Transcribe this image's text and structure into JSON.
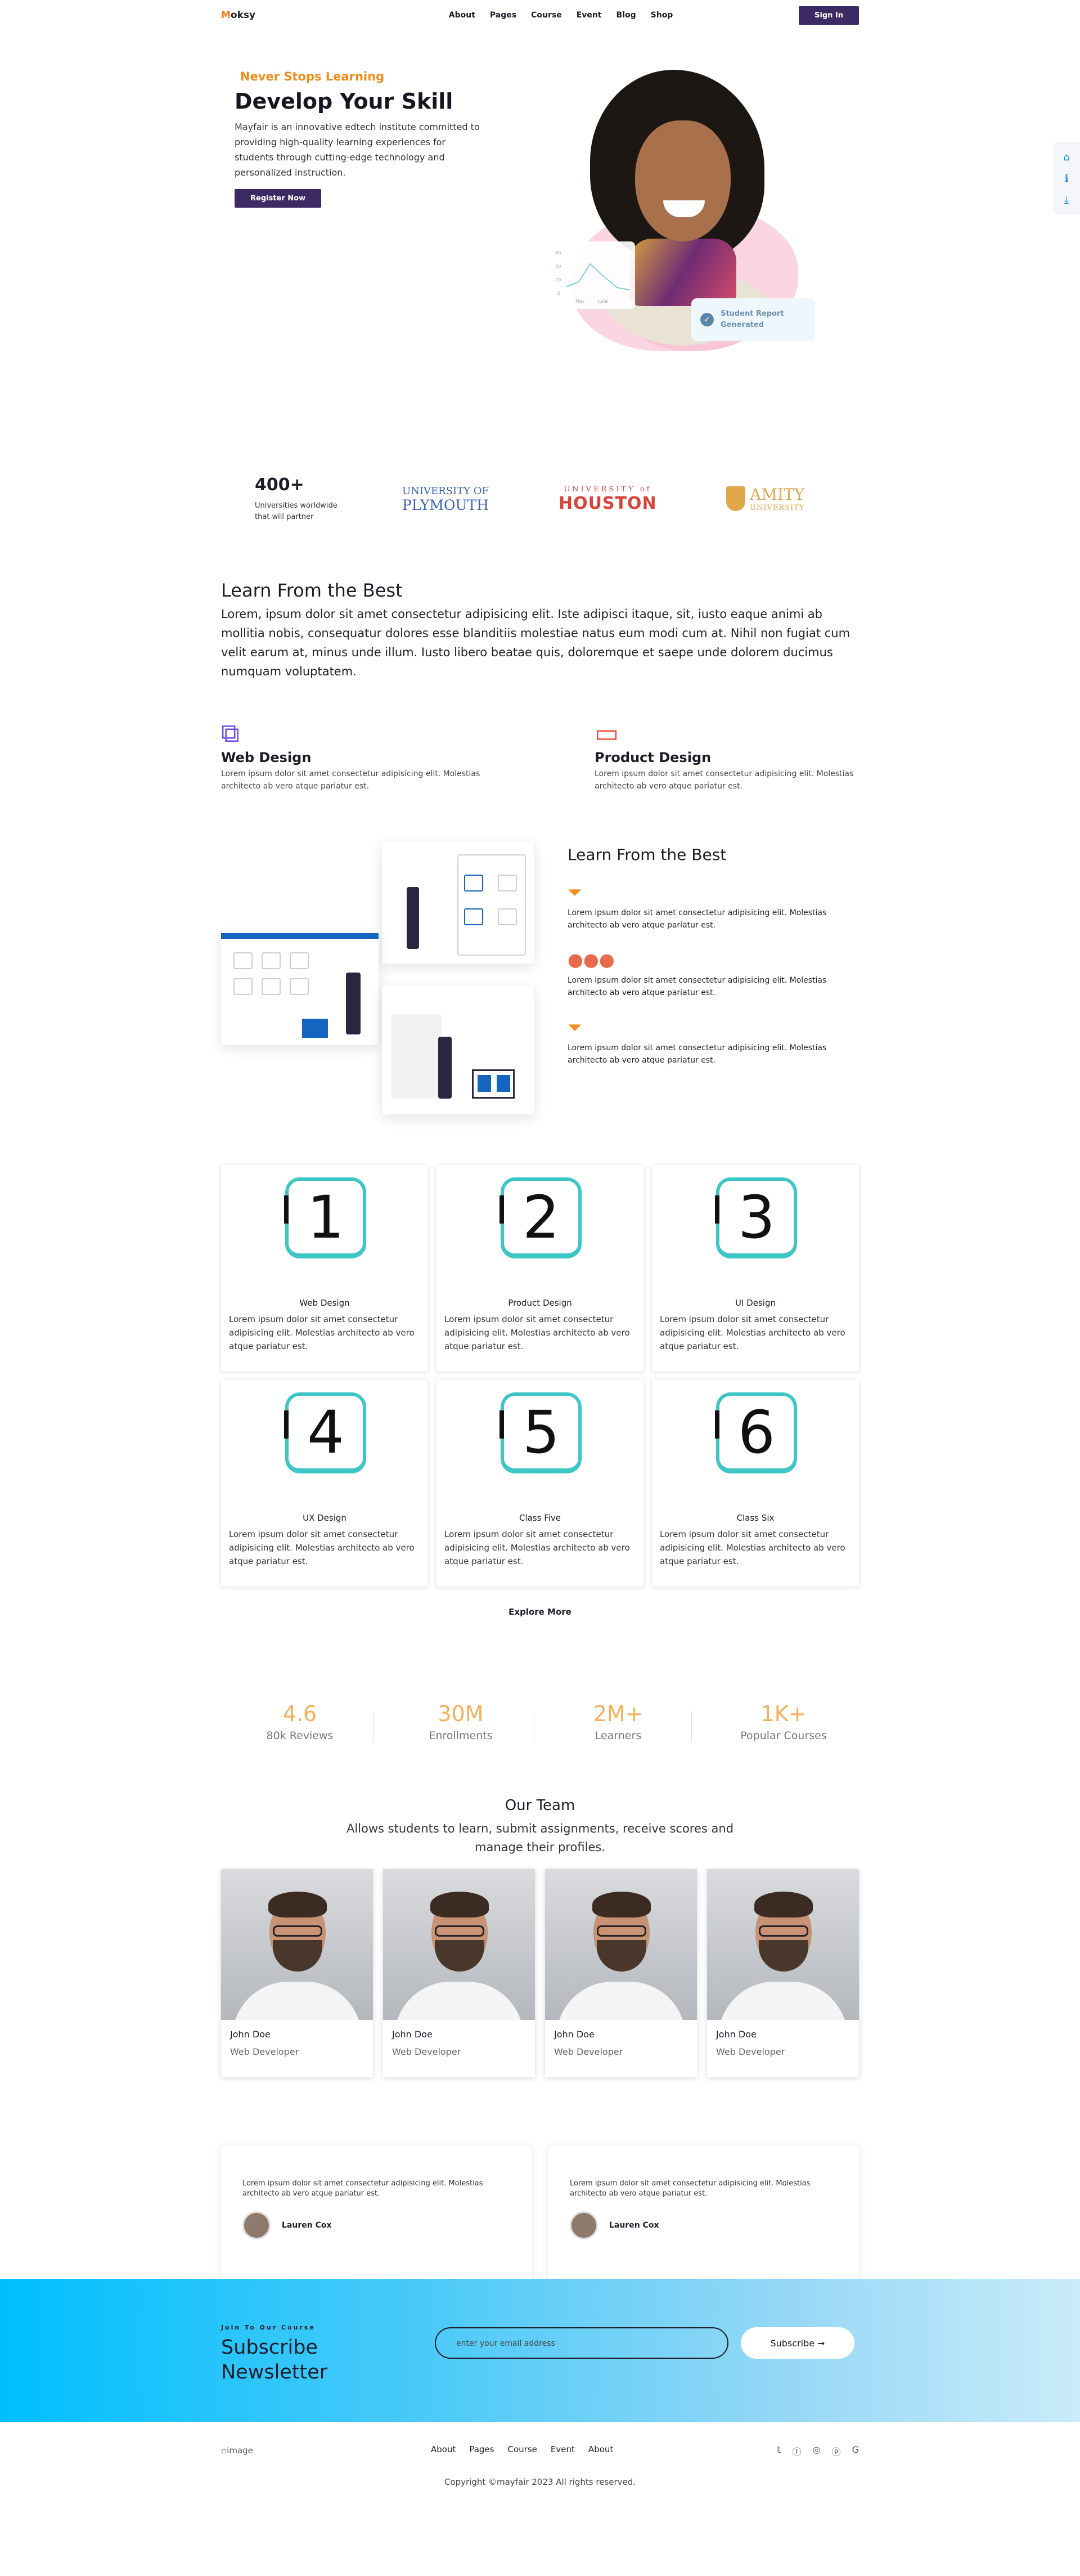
{
  "nav": {
    "logo_initial": "M",
    "logo_rest": "oksy",
    "links": [
      "About",
      "Pages",
      "Course",
      "Event",
      "Blog",
      "Shop"
    ],
    "signin_label": "Sign In"
  },
  "side_tools": [
    "home-icon",
    "info-icon",
    "download-icon"
  ],
  "hero": {
    "kicker": "Never Stops Learning",
    "title": "Develop Your Skill",
    "text": "Mayfair is an innovative edtech institute committed to providing high-quality learning experiences for students through cutting-edge technology and personalized instruction.",
    "button_label": "Register Now",
    "chart_ticks": [
      "60",
      "40",
      "20",
      "0"
    ],
    "chart_months": [
      "May",
      "June"
    ],
    "report_line1": "Student Report",
    "report_line2": "Generated"
  },
  "partners": {
    "count": "400+",
    "count_text": "Universities worldwide that will partner",
    "plymouth_a": "UNIVERSITY OF",
    "plymouth_b": "PLYMOUTH",
    "houston_a": "UNIVERSITY of",
    "houston_b": "HOUSTON",
    "amity_b": "AMITY",
    "amity_a": "UNIVERSITY"
  },
  "learn": {
    "title": "Learn From the Best",
    "text": "Lorem, ipsum dolor sit amet consectetur adipisicing elit. Iste adipisci itaque, sit, iusto eaque animi ab mollitia nobis, consequatur dolores esse blanditiis molestiae natus eum modi cum at. Nihil non fugiat cum velit earum at, minus unde illum. Iusto libero beatae quis, doloremque et saepe unde dolorem ducimus numquam voluptatem."
  },
  "features": [
    {
      "title": "Web Design",
      "text": "Lorem ipsum dolor sit amet consectetur adipisicing elit. Molestias architecto ab vero atque pariatur est.",
      "color": "#6c4ee0"
    },
    {
      "title": "Product Design",
      "text": "Lorem ipsum dolor sit amet consectetur adipisicing elit. Molestias architecto ab vero atque pariatur est.",
      "color": "#e94e3c"
    }
  ],
  "learn_list": {
    "title": "Learn From the Best",
    "items": [
      "Lorem ipsum dolor sit amet consectetur adipisicing elit. Molestias architecto ab vero atque pariatur est.",
      "Lorem ipsum dolor sit amet consectetur adipisicing elit. Molestias architecto ab vero atque pariatur est.",
      "Lorem ipsum dolor sit amet consectetur adipisicing elit. Molestias architecto ab vero atque pariatur est."
    ]
  },
  "courses": [
    {
      "num": "1",
      "title": "Web Design",
      "text": "Lorem ipsum dolor sit amet consectetur adipisicing elit. Molestias architecto ab vero atque pariatur est."
    },
    {
      "num": "2",
      "title": "Product Design",
      "text": "Lorem ipsum dolor sit amet consectetur adipisicing elit. Molestias architecto ab vero atque pariatur est."
    },
    {
      "num": "3",
      "title": "UI Design",
      "text": "Lorem ipsum dolor sit amet consectetur adipisicing elit. Molestias architecto ab vero atque pariatur est."
    },
    {
      "num": "4",
      "title": "UX Design",
      "text": "Lorem ipsum dolor sit amet consectetur adipisicing elit. Molestias architecto ab vero atque pariatur est."
    },
    {
      "num": "5",
      "title": "Class Five",
      "text": "Lorem ipsum dolor sit amet consectetur adipisicing elit. Molestias architecto ab vero atque pariatur est."
    },
    {
      "num": "6",
      "title": "Class Six",
      "text": "Lorem ipsum dolor sit amet consectetur adipisicing elit. Molestias architecto ab vero atque pariatur est."
    }
  ],
  "explore_label": "Explore More",
  "stats": [
    {
      "value": "4.6",
      "label": "80k Reviews"
    },
    {
      "value": "30M",
      "label": "Enrollments"
    },
    {
      "value": "2M+",
      "label": "Learners"
    },
    {
      "value": "1K+",
      "label": "Popular Courses"
    }
  ],
  "team": {
    "title": "Our Team",
    "subtitle": "Allows students to learn, submit assignments, receive scores and manage their profiles.",
    "members": [
      {
        "name": "John Doe",
        "role": "Web Developer"
      },
      {
        "name": "John Doe",
        "role": "Web Developer"
      },
      {
        "name": "John Doe",
        "role": "Web Developer"
      },
      {
        "name": "John Doe",
        "role": "Web Developer"
      }
    ]
  },
  "testimonials": [
    {
      "text": "Lorem ipsum dolor sit amet consectetur adipisicing elit. Molestias architecto ab vero atque pariatur est.",
      "author": "Lauren Cox"
    },
    {
      "text": "Lorem ipsum dolor sit amet consectetur adipisicing elit. Molestias architecto ab vero atque pariatur est.",
      "author": "Lauren Cox"
    }
  ],
  "subscribe": {
    "kicker": "Join To Our Course",
    "title_line1": "Subscribe",
    "title_line2": "Newsletter",
    "placeholder": "enter your email address",
    "button_label": "Subscribe ➞"
  },
  "footer": {
    "image_alt": "image",
    "links": [
      "About",
      "Pages",
      "Course",
      "Event",
      "About"
    ],
    "social": [
      "twitter-icon",
      "facebook-icon",
      "instagram-icon",
      "pinterest-icon",
      "google-icon"
    ],
    "copyright": "Copyright ©mayfair 2023 All rights reserved."
  },
  "colors": {
    "brand": "#3b2a63",
    "accent": "#f08c1a",
    "teal": "#3ec6c6",
    "stat": "#f5b05a"
  }
}
